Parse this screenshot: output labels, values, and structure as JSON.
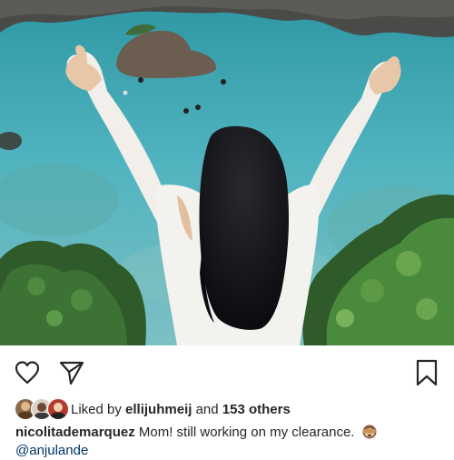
{
  "post": {
    "photo_alt_icon": "photo",
    "liked_prefix": "Liked by",
    "liked_user": "ellijuhmeij",
    "liked_joiner": "and",
    "liked_others": "153 others",
    "caption_user": "nicolitademarquez",
    "caption_text": "Mom! still working on my clearance.",
    "caption_emoji": "see-no-evil-monkey-icon",
    "mention": "@anjulande"
  },
  "colors": {
    "text": "#262626",
    "link": "#003569",
    "water": "#3fa7b5"
  }
}
